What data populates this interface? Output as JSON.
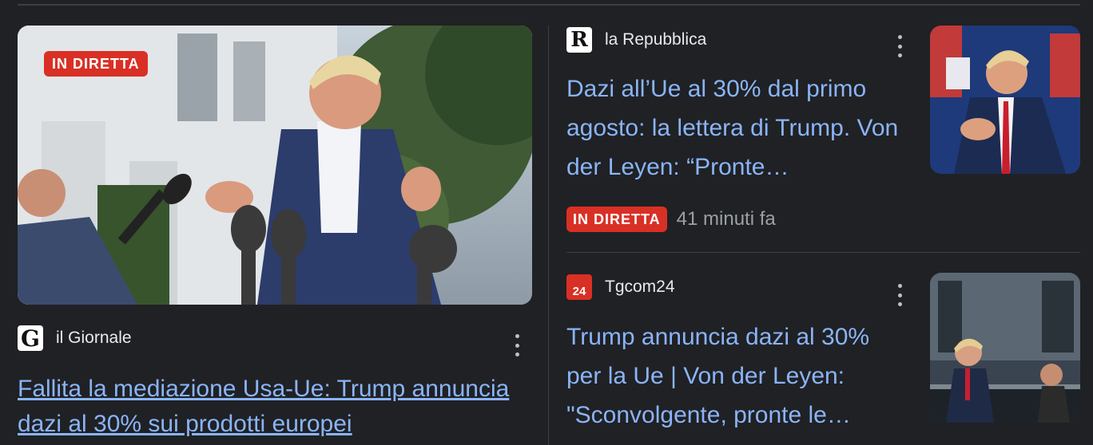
{
  "hero": {
    "badge": "IN DIRETTA",
    "source": {
      "name": "il Giornale",
      "logo_glyph": "G",
      "icon": "il-giornale-logo-icon"
    },
    "title": "Fallita la mediazione Usa-Ue: Trump annuncia dazi al 30% sui prodotti europei"
  },
  "cards": [
    {
      "source": {
        "name": "la Repubblica",
        "logo_glyph": "R",
        "icon": "la-repubblica-logo-icon"
      },
      "title": "Dazi all’Ue al 30% dal primo agosto: la lettera di Trump. Von der Leyen: “Pronte…",
      "badge": "IN DIRETTA",
      "time": "41 minuti fa"
    },
    {
      "source": {
        "name": "Tgcom24",
        "logo_glyph": "24",
        "icon": "tgcom24-logo-icon"
      },
      "title": "Trump annuncia dazi al 30% per la Ue | Von der Leyen: \"Sconvolgente, pronte le…"
    }
  ],
  "colors": {
    "link": "#8ab4f8",
    "live": "#d93025",
    "background": "#202124"
  }
}
